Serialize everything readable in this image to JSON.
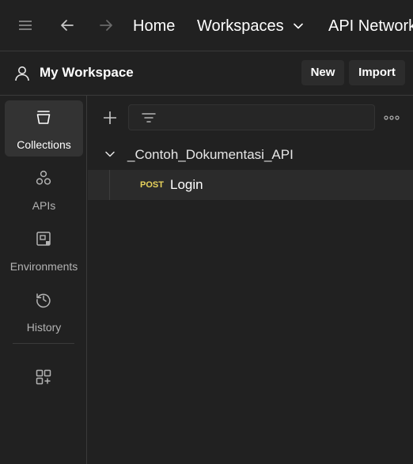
{
  "topbar": {
    "menu_icon": "hamburger-menu-icon",
    "back_icon": "arrow-left-icon",
    "forward_icon": "arrow-right-icon",
    "home_label": "Home",
    "workspaces_label": "Workspaces",
    "workspaces_chevron": "chevron-down-icon",
    "api_network_label": "API Network"
  },
  "workspace": {
    "user_icon": "user-icon",
    "title": "My Workspace",
    "new_label": "New",
    "import_label": "Import"
  },
  "sidebar": {
    "items": [
      {
        "label": "Collections",
        "icon": "collections-icon",
        "active": true
      },
      {
        "label": "APIs",
        "icon": "apis-icon",
        "active": false
      },
      {
        "label": "Environments",
        "icon": "environments-icon",
        "active": false
      },
      {
        "label": "History",
        "icon": "history-icon",
        "active": false
      }
    ],
    "apps_icon": "configure-sidebar-icon"
  },
  "main": {
    "add_icon": "plus-icon",
    "filter_icon": "filter-icon",
    "search_placeholder": "",
    "more_icon": "more-options-icon",
    "collection": {
      "name": "_Contoh_Dokumentasi_API",
      "expanded": true,
      "requests": [
        {
          "method": "POST",
          "name": "Login"
        }
      ]
    }
  },
  "colors": {
    "background": "#212121",
    "active_item": "#333333",
    "post_method": "#e8d35c",
    "border": "#3a3a3a"
  }
}
